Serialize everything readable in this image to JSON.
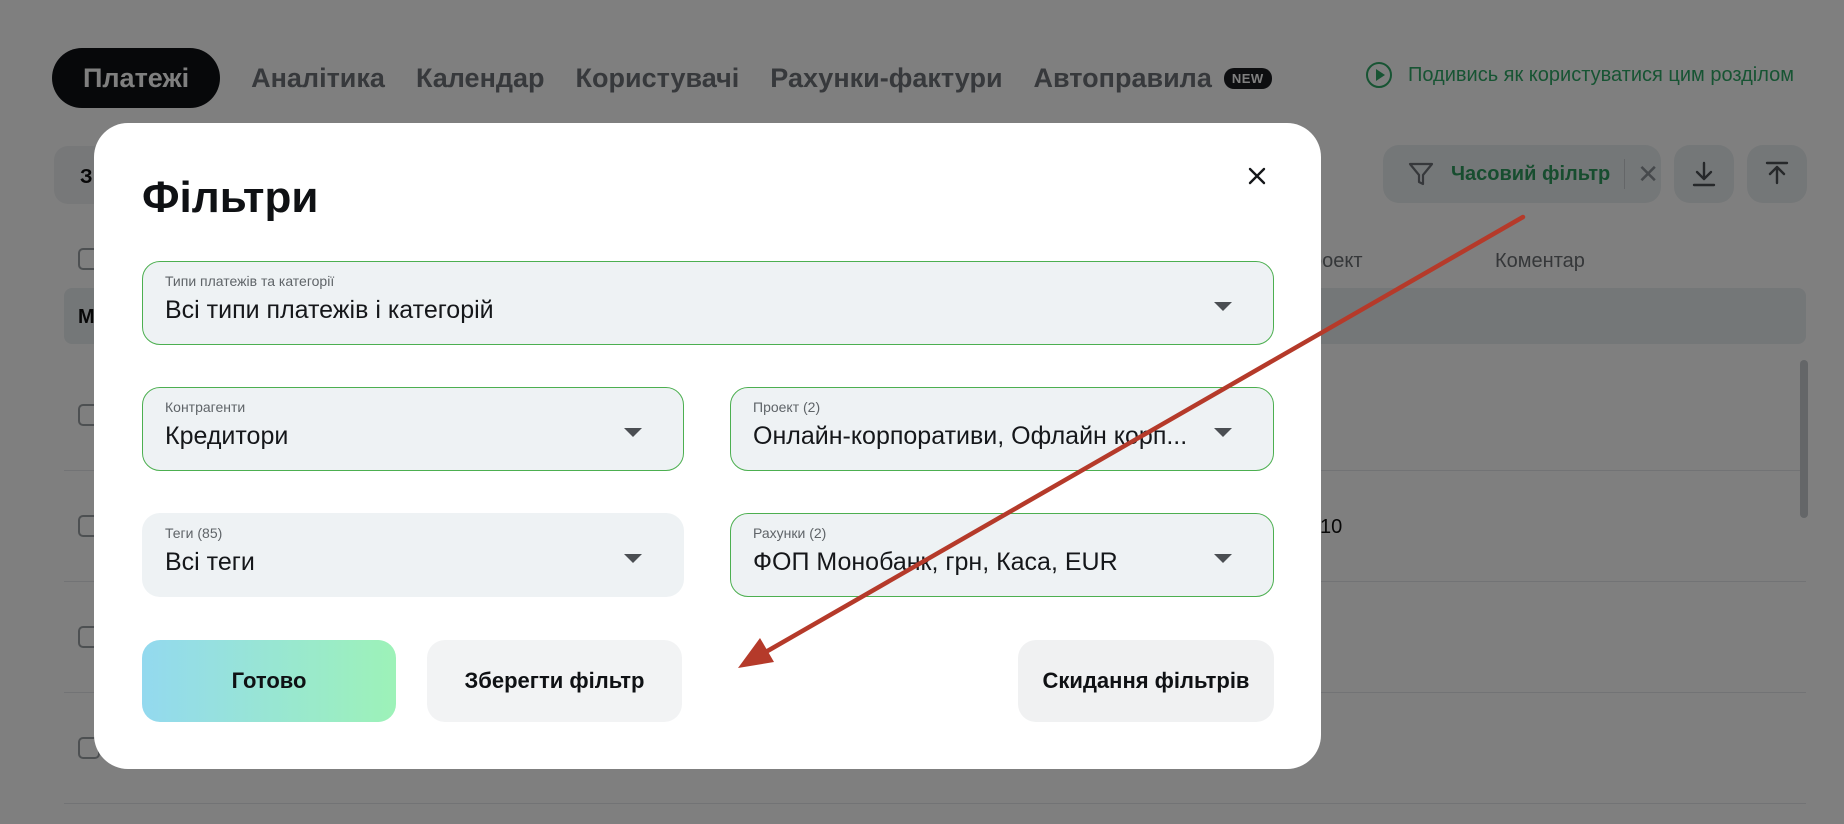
{
  "nav": {
    "tabs": [
      "Платежі",
      "Аналітика",
      "Календар",
      "Користувачі",
      "Рахунки-фактури",
      "Автоправила"
    ],
    "new_badge": "NEW",
    "howto_link": "Подивись як користуватися цим розділом"
  },
  "toolbar": {
    "left_partial": "З",
    "temp_filter": "Часовий фільтр",
    "download_icon": "download-icon",
    "upload_icon": "upload-icon"
  },
  "table": {
    "columns": [
      "роект",
      "Коментар"
    ],
    "group_label": "М",
    "row_values": [
      "10"
    ]
  },
  "modal": {
    "title": "Фільтри",
    "fields": {
      "payment_types": {
        "label": "Типи платежів та категорії",
        "value": "Всі типи платежів і категорій"
      },
      "counterparties": {
        "label": "Контрагенти",
        "value": "Кредитори"
      },
      "project": {
        "label": "Проект (2)",
        "value": "Онлайн-корпоративи, Офлайн корп..."
      },
      "tags": {
        "label": "Теги (85)",
        "value": "Всі теги"
      },
      "accounts": {
        "label": "Рахунки (2)",
        "value": "ФОП Монобанк, грн, Каса, EUR"
      }
    },
    "buttons": {
      "ready": "Готово",
      "save": "Зберегти фільтр",
      "reset": "Скидання фільтрів"
    }
  },
  "colors": {
    "accent_green": "#2fa866",
    "field_border": "#4caf50",
    "annotation_arrow": "#b53a2a"
  }
}
